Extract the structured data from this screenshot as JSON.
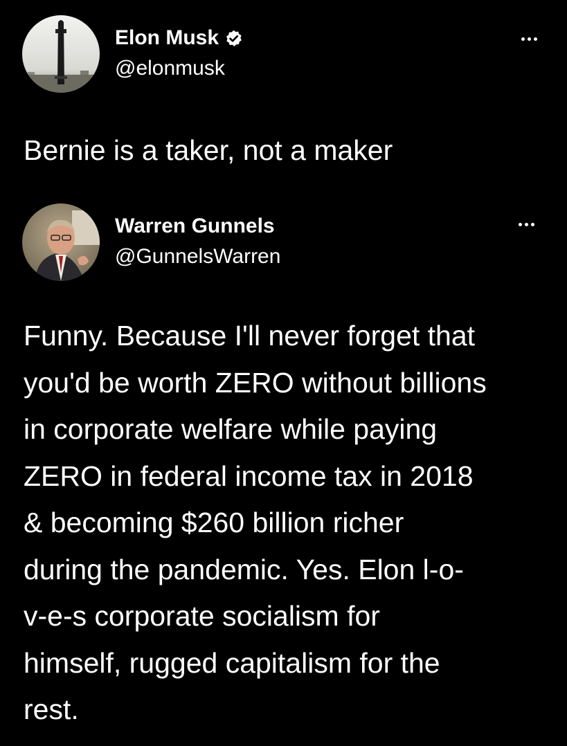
{
  "tweet_main": {
    "author_name": "Elon Musk",
    "verified": true,
    "handle": "@elonmusk",
    "text": "Bernie is a taker, not a maker",
    "avatar_icon": "starship-rocket-avatar",
    "more_icon": "more-options-icon"
  },
  "tweet_quoted": {
    "author_name": "Warren Gunnels",
    "handle": "@GunnelsWarren",
    "text": "Funny. Because I'll never forget that\nyou'd be worth ZERO without billions\nin corporate welfare while paying\nZERO in federal income tax in 2018\n& becoming $260 billion richer\nduring the pandemic. Yes. Elon l-o-\nv-e-s corporate socialism for\nhimself, rugged capitalism for the\nrest.",
    "avatar_icon": "person-photo-avatar",
    "more_icon": "more-options-icon"
  },
  "colors": {
    "background": "#000000",
    "text": "#ffffff",
    "verified_badge": "#ffffff"
  }
}
